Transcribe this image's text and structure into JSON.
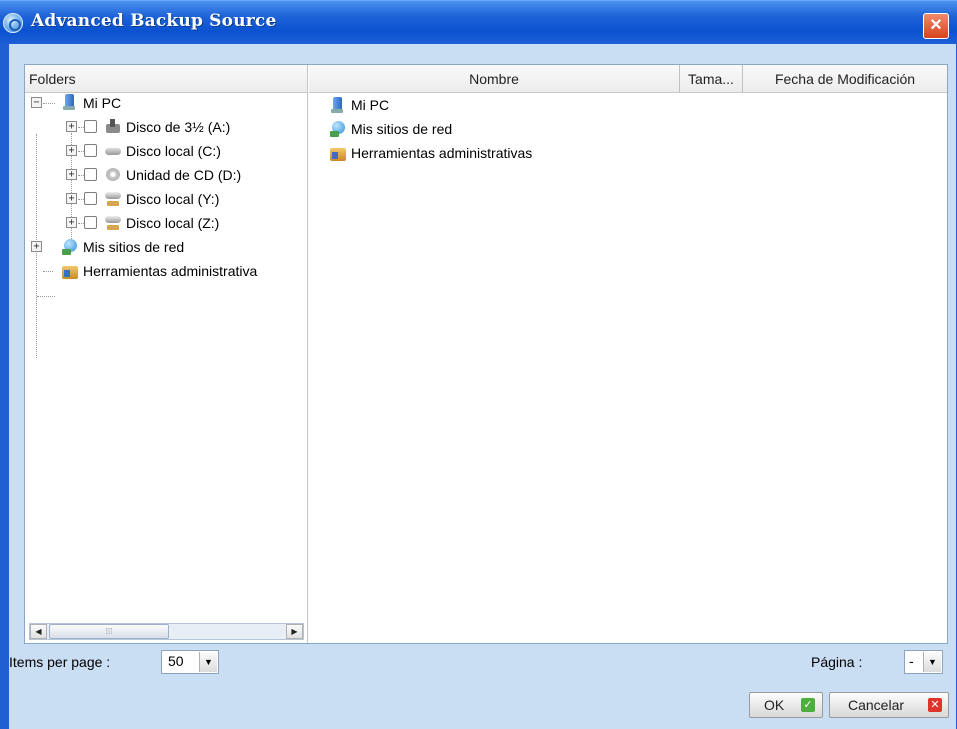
{
  "window": {
    "title": "Advanced Backup Source",
    "close_icon": "close-icon"
  },
  "folders_pane": {
    "header": "Folders",
    "tree": [
      {
        "label": "Mi PC",
        "icon": "computer-icon",
        "expander": "−",
        "checkbox": false,
        "level": 0
      },
      {
        "label": "Disco de 3½ (A:)",
        "icon": "floppy-drive-icon",
        "expander": "+",
        "checkbox": true,
        "level": 1
      },
      {
        "label": "Disco local (C:)",
        "icon": "hard-drive-icon",
        "expander": "+",
        "checkbox": true,
        "level": 1
      },
      {
        "label": "Unidad de CD (D:)",
        "icon": "cd-drive-icon",
        "expander": "+",
        "checkbox": true,
        "level": 1
      },
      {
        "label": "Disco local (Y:)",
        "icon": "network-drive-icon",
        "expander": "+",
        "checkbox": true,
        "level": 1
      },
      {
        "label": "Disco local (Z:)",
        "icon": "network-drive-icon",
        "expander": "+",
        "checkbox": true,
        "level": 1
      },
      {
        "label": "Mis sitios de red",
        "icon": "network-places-icon",
        "expander": "+",
        "checkbox": false,
        "level": 0
      },
      {
        "label": "Herramientas administrativa",
        "icon": "admin-tools-icon",
        "expander": "",
        "checkbox": false,
        "level": 0
      }
    ]
  },
  "file_list": {
    "columns": [
      "Nombre",
      "Tama...",
      "Fecha de Modificación"
    ],
    "rows": [
      {
        "name": "Mi PC",
        "icon": "computer-icon"
      },
      {
        "name": "Mis sitios de red",
        "icon": "network-places-icon"
      },
      {
        "name": "Herramientas administrativas",
        "icon": "admin-tools-icon"
      }
    ]
  },
  "footer": {
    "items_per_page_label": "Items per page :",
    "items_per_page_value": "50",
    "page_label": "Página :",
    "page_value": "-"
  },
  "buttons": {
    "ok": "OK",
    "cancel": "Cancelar"
  },
  "colors": {
    "title_bar": "#0b52d0",
    "window_bg": "#c9ddf3",
    "close_button": "#d8431c",
    "ok_check": "#4caf3c",
    "cancel_x": "#e0332c"
  }
}
